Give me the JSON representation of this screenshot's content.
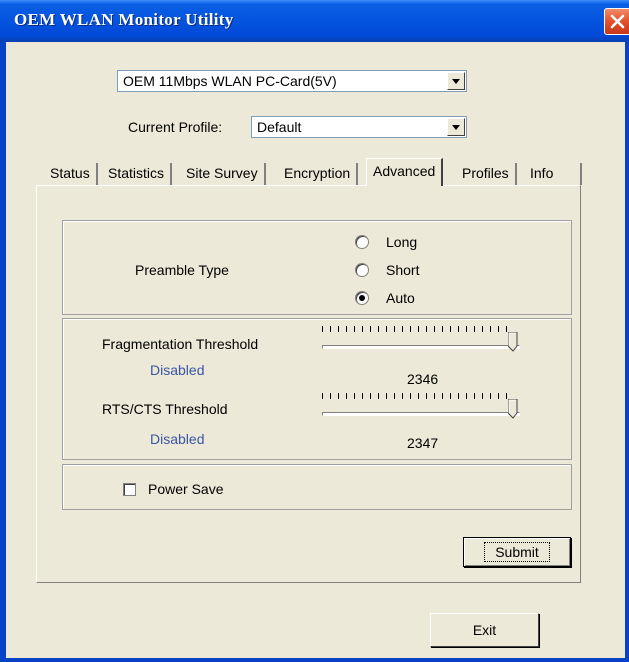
{
  "window": {
    "title": "OEM WLAN Monitor Utility"
  },
  "adapter": {
    "selected": "OEM 11Mbps WLAN PC-Card(5V)"
  },
  "profile": {
    "label": "Current Profile:",
    "selected": "Default"
  },
  "tabs": [
    {
      "label": "Status"
    },
    {
      "label": "Statistics"
    },
    {
      "label": "Site Survey"
    },
    {
      "label": "Encryption"
    },
    {
      "label": "Advanced",
      "active": true
    },
    {
      "label": "Profiles"
    },
    {
      "label": "Info"
    }
  ],
  "advanced": {
    "preamble": {
      "label": "Preamble Type",
      "options": [
        "Long",
        "Short",
        "Auto"
      ],
      "selected": "Auto"
    },
    "fragmentation": {
      "label": "Fragmentation Threshold",
      "status": "Disabled",
      "value": "2346",
      "slider_level": 1.0
    },
    "rts": {
      "label": "RTS/CTS Threshold",
      "status": "Disabled",
      "value": "2347",
      "slider_level": 1.0
    },
    "power_save": {
      "label": "Power Save",
      "checked": false
    }
  },
  "buttons": {
    "submit": "Submit",
    "exit": "Exit"
  },
  "colors": {
    "title_bar": "#0655e0",
    "dialog": "#ece9d8",
    "status_text": "#3a55a4",
    "close_button": "#e2502b"
  }
}
